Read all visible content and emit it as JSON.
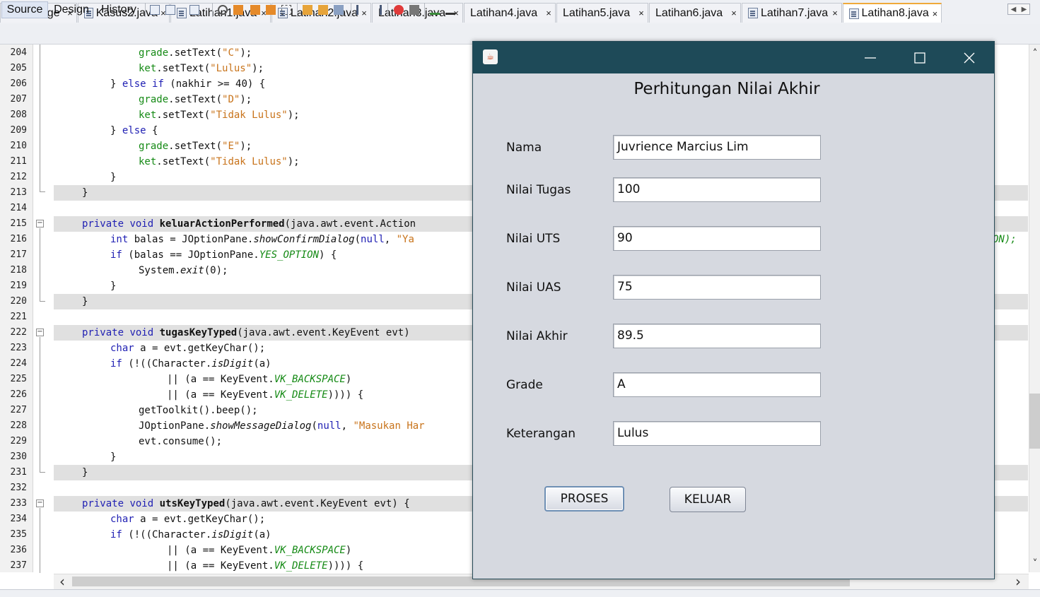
{
  "editor_tabs": [
    {
      "label": "Start Page"
    },
    {
      "label": "Kasus2.java"
    },
    {
      "label": "Latihan1.java"
    },
    {
      "label": "Latihan2.java"
    },
    {
      "label": "Latihan3.java"
    },
    {
      "label": "Latihan4.java"
    },
    {
      "label": "Latihan5.java"
    },
    {
      "label": "Latihan6.java"
    },
    {
      "label": "Latihan7.java"
    },
    {
      "label": "Latihan8.java",
      "active": true
    }
  ],
  "tab_close_glyph": "×",
  "view_tabs": {
    "source": "Source",
    "design": "Design",
    "history": "History"
  },
  "code_lines": [
    {
      "n": "204",
      "text": "grade.setText(\"C\");"
    },
    {
      "n": "205",
      "text": "ket.setText(\"Lulus\");"
    },
    {
      "n": "206",
      "text": "} else if (nakhir >= 40) {"
    },
    {
      "n": "207",
      "text": "grade.setText(\"D\");"
    },
    {
      "n": "208",
      "text": "ket.setText(\"Tidak Lulus\");"
    },
    {
      "n": "209",
      "text": "} else {"
    },
    {
      "n": "210",
      "text": "grade.setText(\"E\");"
    },
    {
      "n": "211",
      "text": "ket.setText(\"Tidak Lulus\");"
    },
    {
      "n": "212",
      "text": "}"
    },
    {
      "n": "213",
      "text": "}"
    },
    {
      "n": "214",
      "text": ""
    },
    {
      "n": "215",
      "text": "private void keluarActionPerformed(java.awt.event.Action"
    },
    {
      "n": "216",
      "text": "int balas = JOptionPane.showConfirmDialog(null, \"Ya"
    },
    {
      "n": "217",
      "text": "if (balas == JOptionPane.YES_OPTION) {"
    },
    {
      "n": "218",
      "text": "System.exit(0);"
    },
    {
      "n": "219",
      "text": "}"
    },
    {
      "n": "220",
      "text": "}"
    },
    {
      "n": "221",
      "text": ""
    },
    {
      "n": "222",
      "text": "private void tugasKeyTyped(java.awt.event.KeyEvent evt)"
    },
    {
      "n": "223",
      "text": "char a = evt.getKeyChar();"
    },
    {
      "n": "224",
      "text": "if (!((Character.isDigit(a)"
    },
    {
      "n": "225",
      "text": "|| (a == KeyEvent.VK_BACKSPACE)"
    },
    {
      "n": "226",
      "text": "|| (a == KeyEvent.VK_DELETE)))) {"
    },
    {
      "n": "227",
      "text": "getToolkit().beep();"
    },
    {
      "n": "228",
      "text": "JOptionPane.showMessageDialog(null, \"Masukan Har"
    },
    {
      "n": "229",
      "text": "evt.consume();"
    },
    {
      "n": "230",
      "text": "}"
    },
    {
      "n": "231",
      "text": "}"
    },
    {
      "n": "232",
      "text": ""
    },
    {
      "n": "233",
      "text": "private void utsKeyTyped(java.awt.event.KeyEvent evt) {"
    },
    {
      "n": "234",
      "text": "char a = evt.getKeyChar();"
    },
    {
      "n": "235",
      "text": "if (!((Character.isDigit(a)"
    },
    {
      "n": "236",
      "text": "|| (a == KeyEvent.VK_BACKSPACE)"
    },
    {
      "n": "237",
      "text": "|| (a == KeyEvent.VK_DELETE)))) {"
    }
  ],
  "code_overflow_right": "ON);",
  "dialog": {
    "title": "",
    "heading": "Perhitungan Nilai Akhir",
    "fields": [
      {
        "label": "Nama",
        "value": "Juvrience Marcius Lim"
      },
      {
        "label": "Nilai Tugas",
        "value": "100"
      },
      {
        "label": "Nilai UTS",
        "value": "90"
      },
      {
        "label": "Nilai UAS",
        "value": "75"
      },
      {
        "label": "Nilai Akhir",
        "value": "89.5"
      },
      {
        "label": "Grade",
        "value": "A"
      },
      {
        "label": "Keterangan",
        "value": "Lulus"
      }
    ],
    "buttons": {
      "proses": "PROSES",
      "keluar": "KELUAR"
    },
    "window_controls": {
      "minimize": "—",
      "maximize": "☐",
      "close": "✕"
    }
  },
  "scroll": {
    "left_arrow": "‹",
    "right_arrow": "›",
    "up_arrow": "˄",
    "down_arrow": "˅"
  },
  "colors": {
    "keyword": "#1f1fb3",
    "string": "#c8731a",
    "field": "#158a15",
    "dialog_title": "#1e4a58",
    "dialog_bg": "#d6d9e0"
  },
  "icons": {
    "java_app_icon": "java-cup-icon",
    "file": "java-file-icon"
  }
}
